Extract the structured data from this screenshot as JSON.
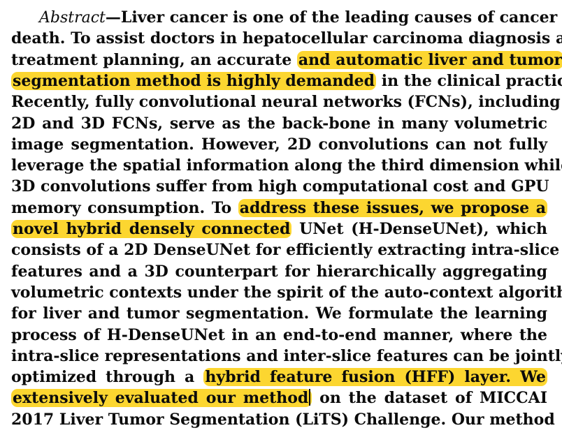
{
  "abstract": {
    "label": "Abstract",
    "dash": "—",
    "lines": [
      {
        "segments": [
          {
            "text": "Liver cancer is one of the leading causes of cancer",
            "highlight": false
          }
        ]
      },
      {
        "segments": [
          {
            "text": "death. To assist doctors in hepatocellular carcinoma diagnosis and",
            "highlight": false
          }
        ]
      },
      {
        "segments": [
          {
            "text": "treatment planning, an accurate ",
            "highlight": false
          },
          {
            "text": "and automatic liver and tumor",
            "highlight": true
          }
        ]
      },
      {
        "segments": [
          {
            "text": "segmentation method is highly demanded",
            "highlight": true
          },
          {
            "text": " in the clinical practice.",
            "highlight": false
          }
        ]
      },
      {
        "segments": [
          {
            "text": "Recently, fully convolutional neural networks (FCNs), including",
            "highlight": false
          }
        ]
      },
      {
        "segments": [
          {
            "text": "2D and 3D FCNs, serve as the back-bone in many volumetric",
            "highlight": false
          }
        ]
      },
      {
        "segments": [
          {
            "text": "image segmentation. However, 2D convolutions can not fully",
            "highlight": false
          }
        ]
      },
      {
        "segments": [
          {
            "text": "leverage the spatial information along the third dimension while",
            "highlight": false
          }
        ]
      },
      {
        "segments": [
          {
            "text": "3D convolutions suffer from high computational cost and GPU",
            "highlight": false
          }
        ]
      },
      {
        "segments": [
          {
            "text": "memory consumption. To ",
            "highlight": false
          },
          {
            "text": "address these issues, we propose a",
            "highlight": true
          }
        ]
      },
      {
        "segments": [
          {
            "text": "novel hybrid densely connected",
            "highlight": true
          },
          {
            "text": " UNet (H-DenseUNet), which",
            "highlight": false
          }
        ]
      },
      {
        "segments": [
          {
            "text": "consists of a 2D DenseUNet for efficiently extracting intra-slice",
            "highlight": false
          }
        ]
      },
      {
        "segments": [
          {
            "text": "features and a 3D counterpart for hierarchically aggregating",
            "highlight": false
          }
        ]
      },
      {
        "segments": [
          {
            "text": "volumetric contexts under the spirit of the auto-context algorithm",
            "highlight": false
          }
        ]
      },
      {
        "segments": [
          {
            "text": "for liver and tumor segmentation. We formulate the learning",
            "highlight": false
          }
        ]
      },
      {
        "segments": [
          {
            "text": "process of H-DenseUNet in an end-to-end manner, where the",
            "highlight": false
          }
        ]
      },
      {
        "segments": [
          {
            "text": "intra-slice representations and inter-slice features can be jointly",
            "highlight": false
          }
        ]
      },
      {
        "segments": [
          {
            "text": "optimized through a ",
            "highlight": false
          },
          {
            "text": "hybrid feature fusion (HFF) layer. We",
            "highlight": true
          }
        ]
      },
      {
        "segments": [
          {
            "text": "extensively evaluated our method",
            "highlight": true,
            "caret": true
          },
          {
            "text": " on the dataset of MICCAI",
            "highlight": false
          }
        ]
      },
      {
        "segments": [
          {
            "text": "2017 Liver Tumor Segmentation (LiTS) Challenge. Our method",
            "highlight": false
          }
        ]
      }
    ]
  },
  "colors": {
    "highlight": "#fcd630",
    "text": "#0b0b0b",
    "background": "#ffffff"
  }
}
